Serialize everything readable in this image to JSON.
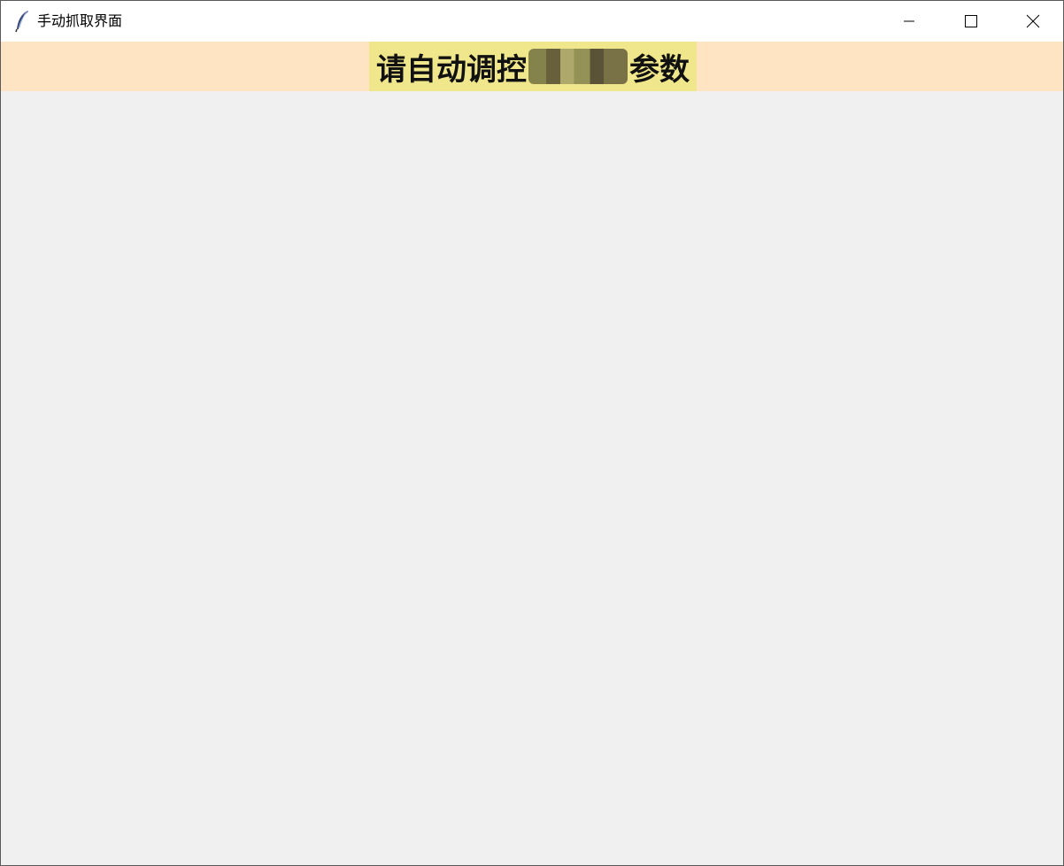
{
  "window": {
    "title": "手动抓取界面",
    "icon": "feather-icon",
    "controls": {
      "minimize": "minimize-icon",
      "maximize": "maximize-icon",
      "close": "close-icon"
    }
  },
  "header": {
    "label_prefix": "请自动调控",
    "label_suffix": "参数",
    "band_color": "#ffe4c4",
    "label_bg_color": "#f0e68c"
  }
}
